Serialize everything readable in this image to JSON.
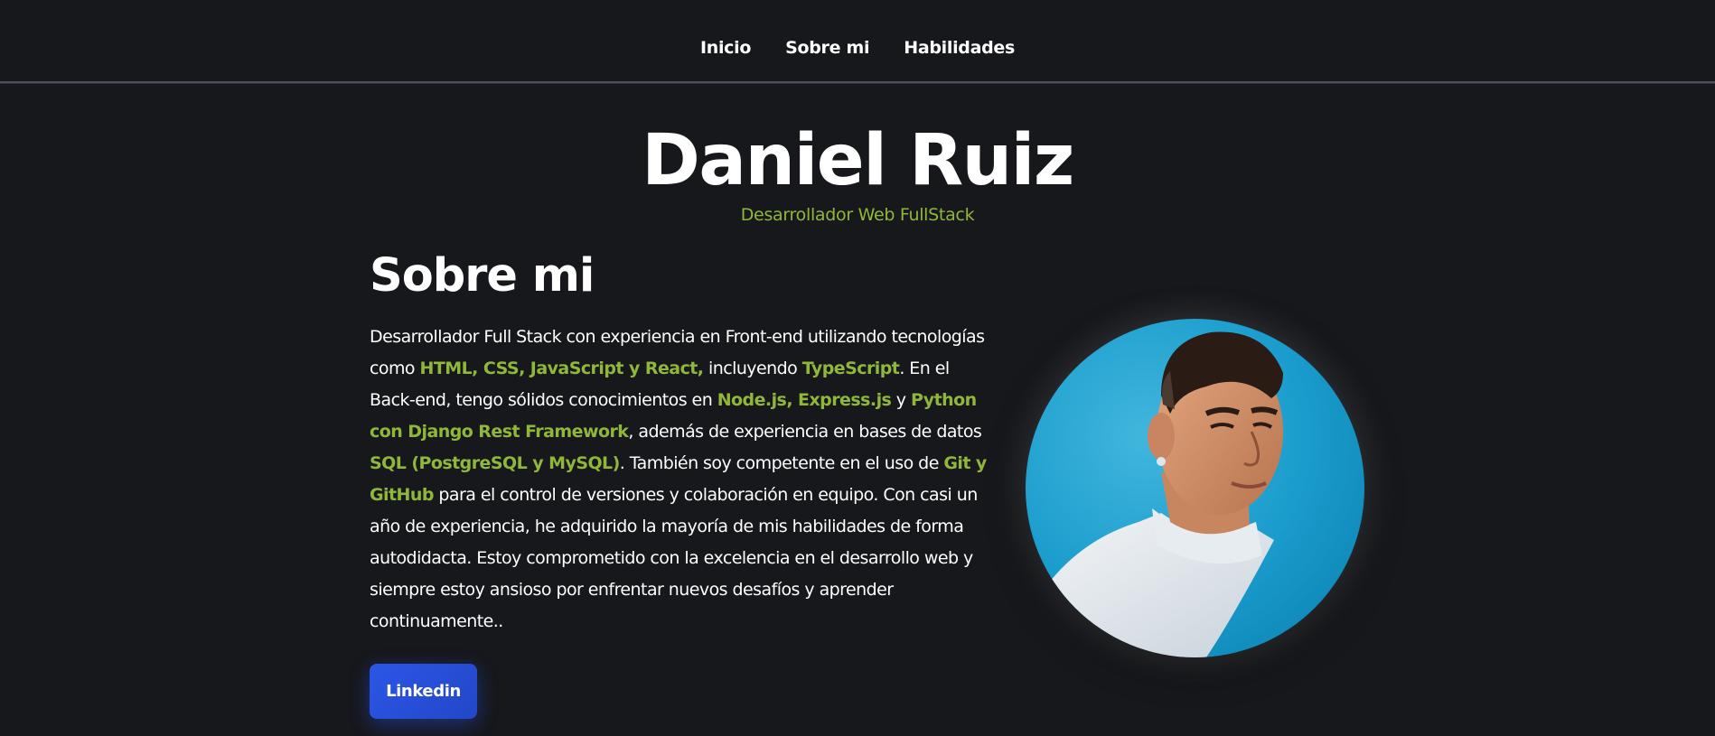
{
  "nav": {
    "items": [
      {
        "label": "Inicio"
      },
      {
        "label": "Sobre mi"
      },
      {
        "label": "Habilidades"
      }
    ]
  },
  "hero": {
    "name": "Daniel Ruiz",
    "role": "Desarrollador Web FullStack"
  },
  "about": {
    "title": "Sobre mi",
    "paragraph": [
      {
        "text": "Desarrollador Full Stack con experiencia en Front-end utilizando tecnologías como ",
        "highlight": false
      },
      {
        "text": "HTML, CSS, JavaScript y React,",
        "highlight": true
      },
      {
        "text": " incluyendo ",
        "highlight": false
      },
      {
        "text": "TypeScript",
        "highlight": true
      },
      {
        "text": ". En el Back-end, tengo sólidos conocimientos en ",
        "highlight": false
      },
      {
        "text": "Node.js, Express.js",
        "highlight": true
      },
      {
        "text": " y ",
        "highlight": false
      },
      {
        "text": "Python con Django Rest Framework",
        "highlight": true
      },
      {
        "text": ", además de experiencia en bases de datos ",
        "highlight": false
      },
      {
        "text": "SQL (PostgreSQL y MySQL)",
        "highlight": true
      },
      {
        "text": ". También soy competente en el uso de ",
        "highlight": false
      },
      {
        "text": "Git y GitHub",
        "highlight": true
      },
      {
        "text": " para el control de versiones y colaboración en equipo. Con casi un año de experiencia, he adquirido la mayoría de mis habilidades de forma autodidacta. Estoy comprometido con la excelencia en el desarrollo web y siempre estoy ansioso por enfrentar nuevos desafíos y aprender continuamente..",
        "highlight": false
      }
    ],
    "linkedin_label": "Linkedin"
  },
  "colors": {
    "background": "#17181c",
    "accent_green": "#8fb83a",
    "button_blue": "#2b56e6",
    "avatar_background": "#1a9ccc"
  },
  "icons": {
    "profile_photo": "portrait-photo"
  }
}
